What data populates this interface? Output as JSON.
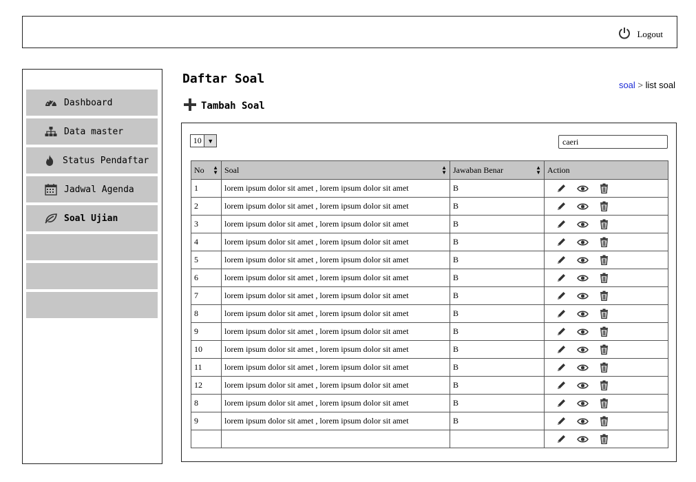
{
  "header": {
    "logout_label": "Logout"
  },
  "sidebar": {
    "items": [
      {
        "label": "Dashboard",
        "icon": "dashboard-icon",
        "active": false
      },
      {
        "label": "Data master",
        "icon": "sitemap-icon",
        "active": false
      },
      {
        "label": "Status Pendaftar",
        "icon": "fire-icon",
        "active": false
      },
      {
        "label": "Jadwal Agenda",
        "icon": "calendar-icon",
        "active": false
      },
      {
        "label": "Soal Ujian",
        "icon": "leaf-icon",
        "active": true
      },
      {
        "label": ""
      },
      {
        "label": ""
      },
      {
        "label": ""
      }
    ]
  },
  "main": {
    "title": "Daftar Soal",
    "breadcrumb": {
      "link": "soal",
      "separator": ">",
      "current": "list soal"
    },
    "add_label": "Tambah Soal",
    "page_size": "10",
    "search_value": "caeri",
    "table": {
      "columns": [
        "No",
        "Soal",
        "Jawaban Benar",
        "Action"
      ],
      "rows": [
        {
          "no": "1",
          "soal": "lorem ipsum dolor sit amet , lorem ipsum dolor sit amet",
          "jawaban": "B"
        },
        {
          "no": "2",
          "soal": "lorem ipsum dolor sit amet , lorem ipsum dolor sit amet",
          "jawaban": "B"
        },
        {
          "no": "3",
          "soal": "lorem ipsum dolor sit amet , lorem ipsum dolor sit amet",
          "jawaban": "B"
        },
        {
          "no": "4",
          "soal": "lorem ipsum dolor sit amet , lorem ipsum dolor sit amet",
          "jawaban": "B"
        },
        {
          "no": "5",
          "soal": "lorem ipsum dolor sit amet , lorem ipsum dolor sit amet",
          "jawaban": "B"
        },
        {
          "no": "6",
          "soal": "lorem ipsum dolor sit amet , lorem ipsum dolor sit amet",
          "jawaban": "B"
        },
        {
          "no": "7",
          "soal": "lorem ipsum dolor sit amet , lorem ipsum dolor sit amet",
          "jawaban": "B"
        },
        {
          "no": "8",
          "soal": "lorem ipsum dolor sit amet , lorem ipsum dolor sit amet",
          "jawaban": "B"
        },
        {
          "no": "9",
          "soal": "lorem ipsum dolor sit amet , lorem ipsum dolor sit amet",
          "jawaban": "B"
        },
        {
          "no": "10",
          "soal": "lorem ipsum dolor sit amet , lorem ipsum dolor sit amet",
          "jawaban": "B"
        },
        {
          "no": "11",
          "soal": "lorem ipsum dolor sit amet , lorem ipsum dolor sit amet",
          "jawaban": "B"
        },
        {
          "no": "12",
          "soal": "lorem ipsum dolor sit amet , lorem ipsum dolor sit amet",
          "jawaban": "B"
        },
        {
          "no": "8",
          "soal": "lorem ipsum dolor sit amet , lorem ipsum dolor sit amet",
          "jawaban": "B"
        },
        {
          "no": "9",
          "soal": "lorem ipsum dolor sit amet , lorem ipsum dolor sit amet",
          "jawaban": "B"
        },
        {
          "no": "",
          "soal": "",
          "jawaban": ""
        }
      ]
    }
  }
}
